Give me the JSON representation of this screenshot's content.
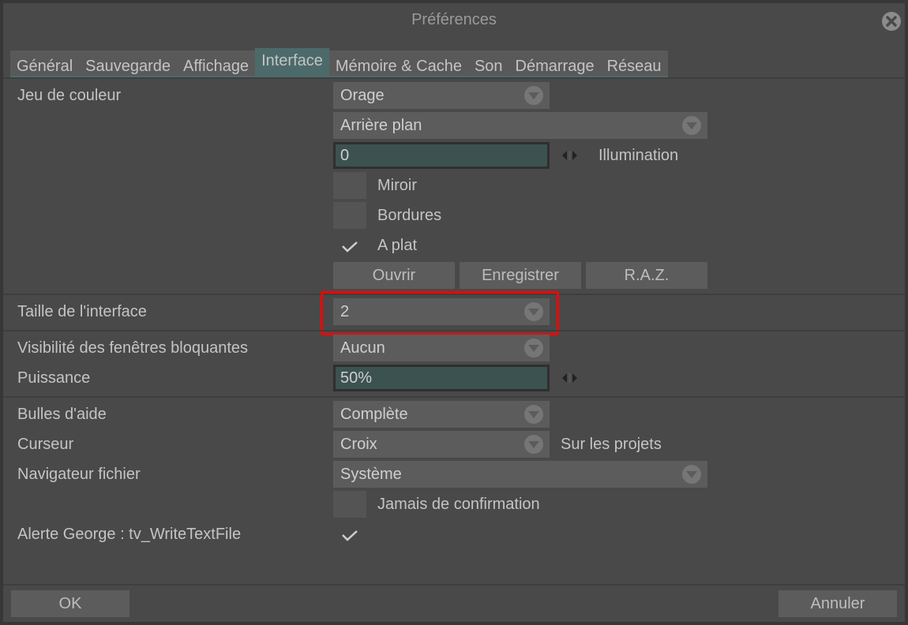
{
  "window": {
    "title": "Préférences",
    "close_icon": "close-circle-icon"
  },
  "tabs": [
    {
      "label": "Général",
      "active": false
    },
    {
      "label": "Sauvegarde",
      "active": false
    },
    {
      "label": "Affichage",
      "active": false
    },
    {
      "label": "Interface",
      "active": true
    },
    {
      "label": "Mémoire & Cache",
      "active": false
    },
    {
      "label": "Son",
      "active": false
    },
    {
      "label": "Démarrage",
      "active": false
    },
    {
      "label": "Réseau",
      "active": false
    }
  ],
  "color_scheme": {
    "label": "Jeu de couleur",
    "theme_select": "Orage",
    "element_select": "Arrière plan",
    "illumination_value": "0",
    "illumination_label": "Illumination",
    "mirror_label": "Miroir",
    "mirror_checked": false,
    "borders_label": "Bordures",
    "borders_checked": false,
    "flat_label": "A plat",
    "flat_checked": true,
    "open_button": "Ouvrir",
    "save_button": "Enregistrer",
    "reset_button": "R.A.Z."
  },
  "interface_size": {
    "label": "Taille de l'interface",
    "value": "2"
  },
  "blocking_windows": {
    "label": "Visibilité des fenêtres bloquantes",
    "value": "Aucun"
  },
  "power": {
    "label": "Puissance",
    "value": "50%"
  },
  "tooltips": {
    "label": "Bulles d'aide",
    "value": "Complète"
  },
  "cursor": {
    "label": "Curseur",
    "value": "Croix",
    "suffix": "Sur les projets"
  },
  "file_browser": {
    "label": "Navigateur fichier",
    "value": "Système",
    "never_confirm_label": "Jamais de confirmation",
    "never_confirm_checked": false
  },
  "george_alert": {
    "label": "Alerte George : tv_WriteTextFile",
    "checked": true
  },
  "footer": {
    "ok_button": "OK",
    "cancel_button": "Annuler"
  },
  "colors": {
    "accent": "#4d6a6a",
    "field_bg": "#3c5251",
    "highlight": "#ff0000"
  }
}
